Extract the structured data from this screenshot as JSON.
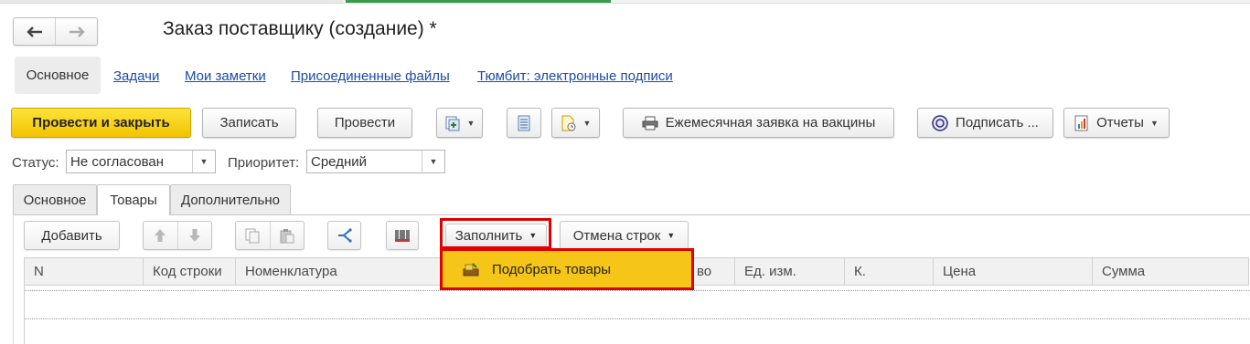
{
  "window": {
    "title": "Заказ поставщику (создание) *"
  },
  "nav_tabs": {
    "main": "Основное",
    "links": [
      "Задачи",
      "Мои заметки",
      "Присоединенные файлы",
      "Тюмбит: электронные подписи"
    ]
  },
  "toolbar": {
    "post_close": "Провести и закрыть",
    "save": "Записать",
    "post": "Провести",
    "monthly_request": "Ежемесячная заявка на вакцины",
    "sign": "Подписать ...",
    "reports": "Отчеты"
  },
  "fields": {
    "status_label": "Статус:",
    "status_value": "Не согласован",
    "priority_label": "Приоритет:",
    "priority_value": "Средний"
  },
  "content_tabs": [
    "Основное",
    "Товары",
    "Дополнительно"
  ],
  "active_content_tab": "Товары",
  "table_toolbar": {
    "add": "Добавить",
    "fill": "Заполнить",
    "cancel_rows": "Отмена строк"
  },
  "fill_menu": {
    "items": [
      "Подобрать товары"
    ]
  },
  "table": {
    "columns": [
      "N",
      "Код строки",
      "Номенклатура",
      "во",
      "Ед. изм.",
      "К.",
      "Цена",
      "Сумма"
    ]
  },
  "colors": {
    "primary_button": "#f5c518",
    "highlight_border": "#e00000",
    "link": "#1a4ca8"
  }
}
